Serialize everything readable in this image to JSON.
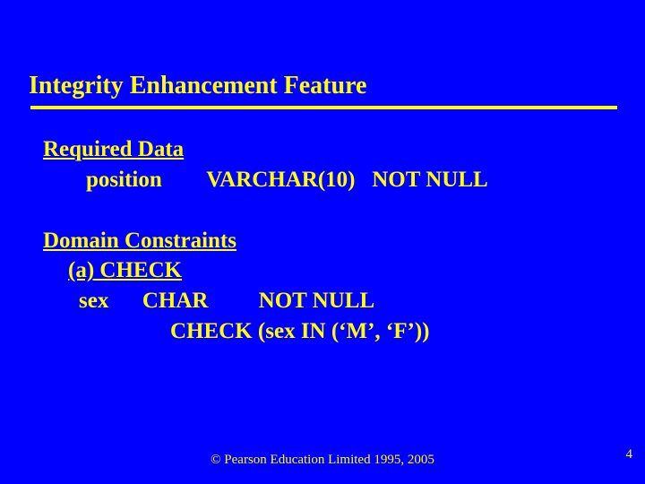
{
  "title": "Integrity Enhancement Feature",
  "section1": {
    "heading": "Required Data",
    "row": "position        VARCHAR(10)   NOT NULL"
  },
  "section2": {
    "heading": "Domain Constraints",
    "subheading": "(a) CHECK",
    "row1": "sex      CHAR         NOT NULL",
    "row2": "CHECK (sex IN (‘M’, ‘F’))"
  },
  "footer": "© Pearson Education Limited 1995, 2005",
  "page_number": "4"
}
